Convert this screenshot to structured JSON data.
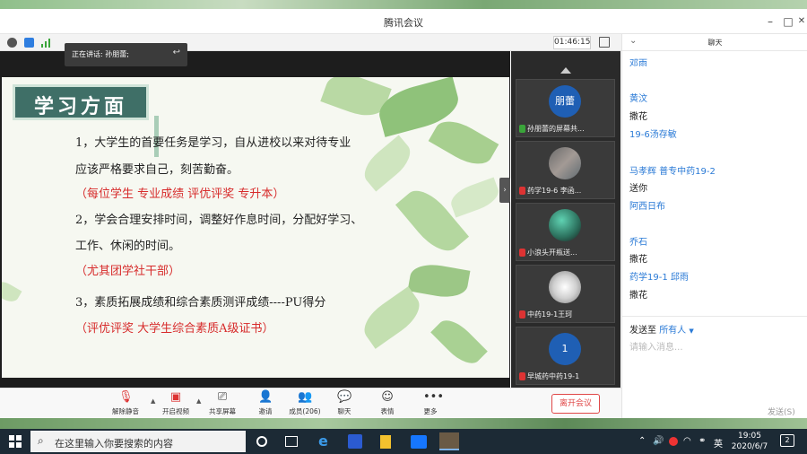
{
  "window": {
    "title": "腾讯会议",
    "minimize": "–",
    "maximize": "□",
    "close": "✕"
  },
  "statusbar": {
    "timer": "01:46:15"
  },
  "slide": {
    "title": "学习方面",
    "lines": [
      {
        "text": "1，大学生的首要任务是学习，自从进校以来对待专业",
        "style": "black"
      },
      {
        "text": "应该严格要求自己，刻苦勤奋。",
        "style": "black"
      },
      {
        "text": "（每位学生  专业成绩   评优评奖    专升本）",
        "style": "red"
      },
      {
        "text": "2，学会合理安排时间，调整好作息时间，分配好学习、",
        "style": "black"
      },
      {
        "text": "工作、休闲的时间。",
        "style": "black"
      },
      {
        "text": "（尤其团学社干部）",
        "style": "red"
      },
      {
        "text": "3，素质拓展成绩和综合素质测评成绩----PU得分",
        "style": "black"
      },
      {
        "text": "（评优评奖   大学生综合素质A级证书）",
        "style": "red"
      }
    ]
  },
  "thumbnails": [
    {
      "name": "孙朋蕾的屏幕共...",
      "avatar_text": "朋蕾",
      "avatar_color": "#1f5fb4"
    },
    {
      "name": "药学19-6 李函...",
      "avatar_text": "",
      "avatar_color": "#8a8a8a"
    },
    {
      "name": "小浪头开瓶送...",
      "avatar_text": "",
      "avatar_color": "#3f8f6f"
    },
    {
      "name": "中药19-1王珂",
      "avatar_text": "",
      "avatar_color": "#d8d8d8"
    },
    {
      "name": "早城药中药19-1",
      "avatar_text": "1",
      "avatar_color": "#1f5fb4"
    }
  ],
  "toolbar": {
    "mute": "解除静音",
    "video": "开启视频",
    "share": "共享屏幕",
    "invite": "邀请",
    "members": "成员(206)",
    "chat": "聊天",
    "emoji": "表情",
    "more": "更多",
    "leave": "离开会议"
  },
  "chat": {
    "title": "聊天",
    "speaker_tip": "正在讲话: 孙朋蕾;",
    "messages": [
      {
        "name": "邓雨",
        "text": ""
      },
      {
        "name": "黄汶",
        "text": "撒花"
      },
      {
        "name": "19-6汤存敏",
        "text": ""
      },
      {
        "name": "马孝辉 普专中药19-2",
        "text": "送你"
      },
      {
        "name": "阿西日布",
        "text": ""
      },
      {
        "name": "乔石",
        "text": "撒花"
      },
      {
        "name": "药学19-1  邱雨",
        "text": "撒花"
      }
    ],
    "send_to_label": "发送至",
    "send_to_target": "所有人",
    "input_placeholder": "请输入消息...",
    "send_button": "发送(S)"
  },
  "taskbar": {
    "search_placeholder": "在这里输入你要搜索的内容",
    "ime": "英",
    "time": "19:05",
    "date": "2020/6/7",
    "notifications": "2"
  }
}
